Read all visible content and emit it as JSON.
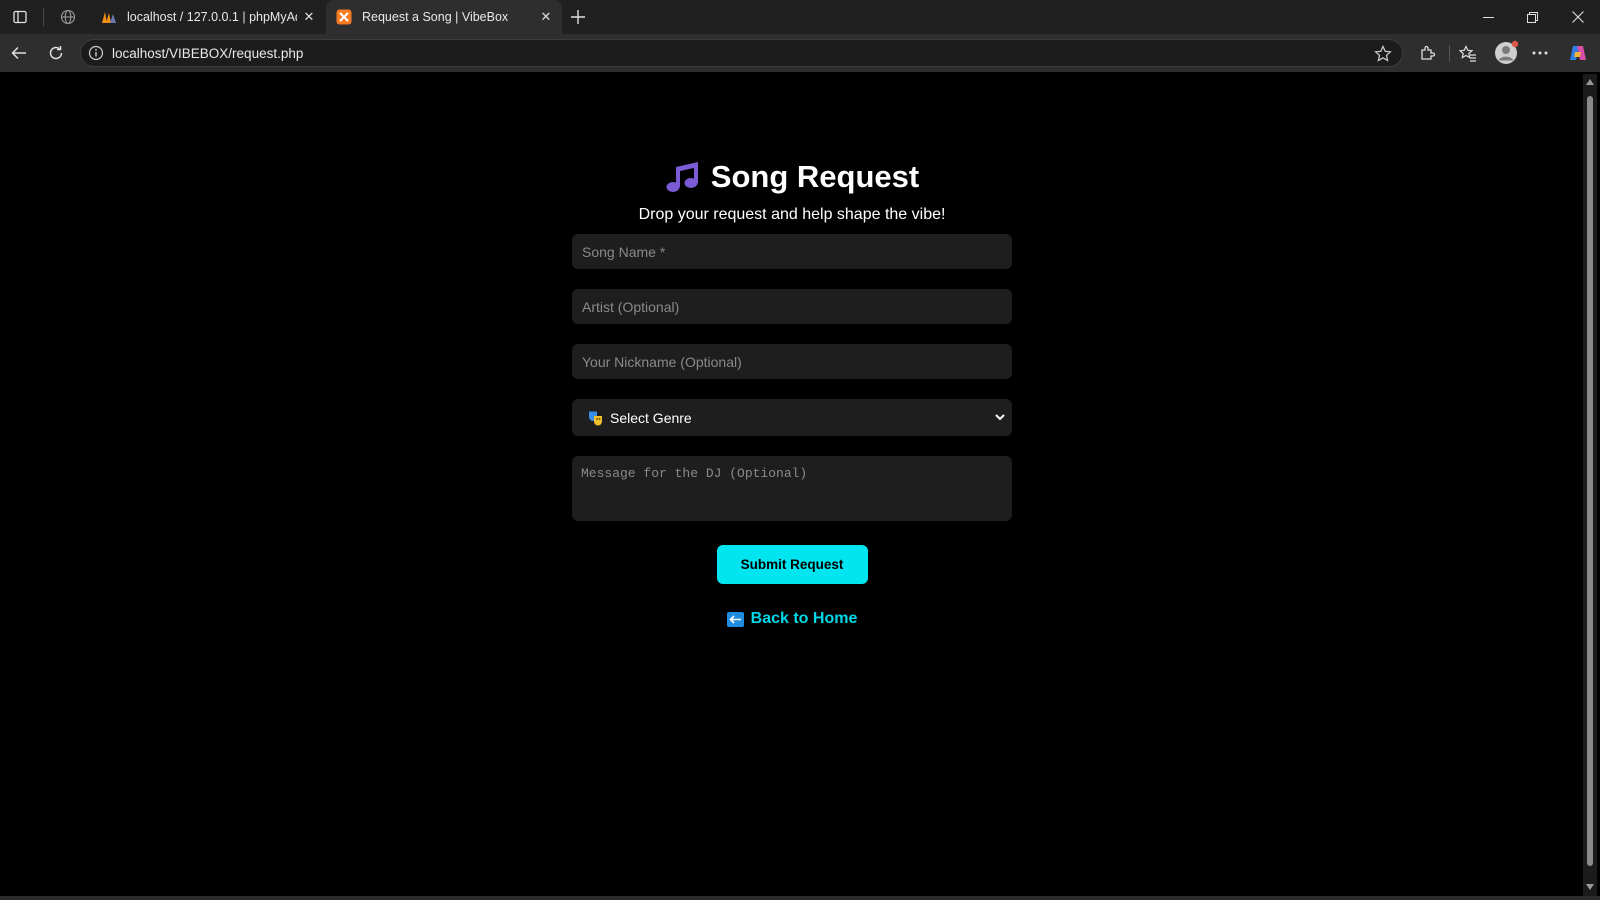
{
  "browser": {
    "tabs": [
      {
        "title": "localhost / 127.0.0.1 | phpMyAdm",
        "icon": "phpmyadmin-icon",
        "active": false
      },
      {
        "title": "Request a Song | VibeBox",
        "icon": "xampp-icon",
        "active": true
      }
    ],
    "url": "localhost/VIBEBOX/request.php"
  },
  "page": {
    "title": "Song Request",
    "title_icon": "music-note-icon",
    "subtitle": "Drop your request and help shape the vibe!",
    "form": {
      "song_placeholder": "Song Name *",
      "artist_placeholder": "Artist (Optional)",
      "nickname_placeholder": "Your Nickname (Optional)",
      "genre_selected": "Select Genre",
      "genre_icon": "theater-masks-icon",
      "message_placeholder": "Message for the DJ (Optional)",
      "submit_label": "Submit Request"
    },
    "back_link": "Back to Home"
  },
  "colors": {
    "background": "#000000",
    "accent": "#00e5f0",
    "link": "#00d8e8",
    "field_bg": "#1e1e1e"
  }
}
